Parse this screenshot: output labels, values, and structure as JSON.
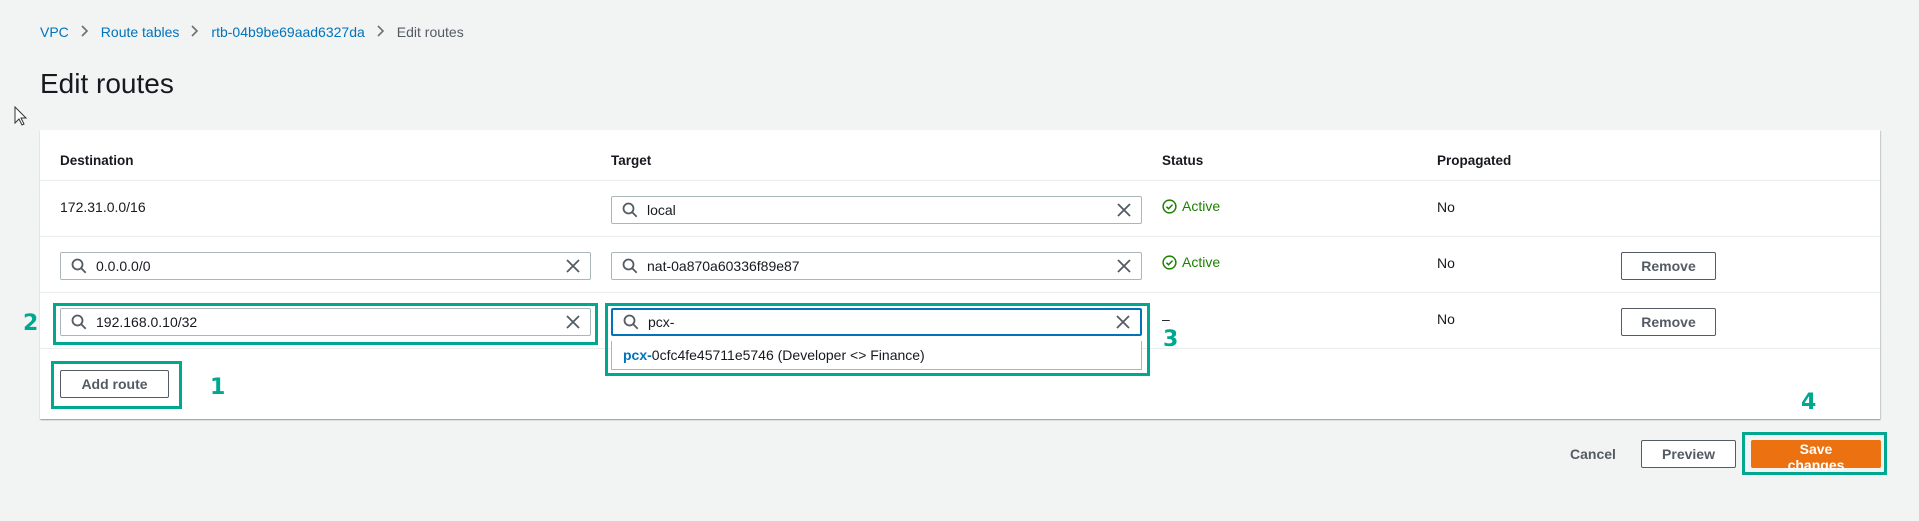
{
  "breadcrumb": {
    "items": [
      "VPC",
      "Route tables",
      "rtb-04b9be69aad6327da"
    ],
    "current": "Edit routes"
  },
  "page_title": "Edit routes",
  "table": {
    "headers": [
      "Destination",
      "Target",
      "Status",
      "Propagated"
    ],
    "rows": [
      {
        "destination": "172.31.0.0/16",
        "target": "local",
        "status": "Active",
        "propagated": "No"
      },
      {
        "destination": "0.0.0.0/0",
        "target": "nat-0a870a60336f89e87",
        "status": "Active",
        "propagated": "No",
        "remove_label": "Remove"
      },
      {
        "destination": "192.168.0.10/32",
        "target": "pcx-",
        "status": "–",
        "propagated": "No",
        "remove_label": "Remove"
      }
    ]
  },
  "dropdown": {
    "match": "pcx-",
    "rest": "0cfc4fe45711e5746 (Developer <> Finance)"
  },
  "add_route_label": "Add route",
  "footer": {
    "cancel_label": "Cancel",
    "preview_label": "Preview",
    "save_label": "Save changes"
  },
  "callouts": [
    "1",
    "2",
    "3",
    "4"
  ],
  "colors": {
    "accent": "#ec7211",
    "link": "#0073bb",
    "success": "#1d8102",
    "callout": "#00a88f"
  }
}
